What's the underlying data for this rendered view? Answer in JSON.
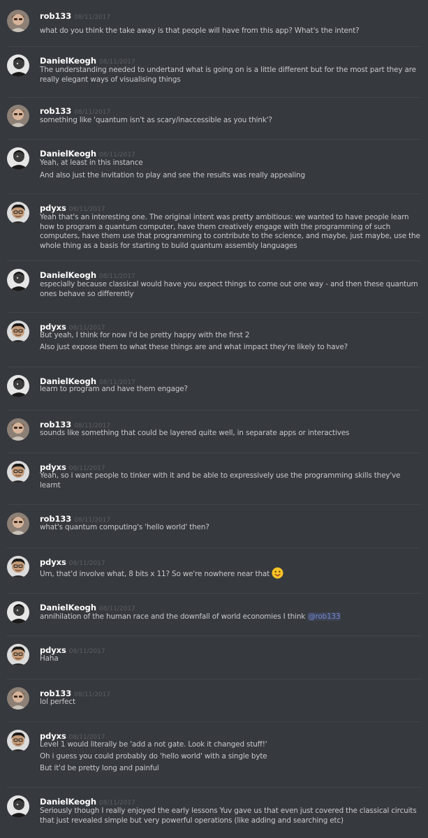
{
  "colors": {
    "background": "#36393e",
    "divider": "#42454a",
    "author": "#ffffff",
    "text": "#c8c9cb",
    "timestamp": "#5b5e63",
    "mention": "#7289da"
  },
  "messages": [
    {
      "author": "rob133",
      "timestamp": "08/11/2017",
      "avatar": "rob133-avatar",
      "lines": [
        "what do you think the take away is that people will have from this app? What's the intent?"
      ]
    },
    {
      "author": "DanielKeogh",
      "timestamp": "08/11/2017",
      "avatar": "danielkeogh-avatar",
      "lines": [
        "The understanding needed to undertand what is going on is a little different but for the most part they are really elegant ways of visualising things"
      ]
    },
    {
      "author": "rob133",
      "timestamp": "08/11/2017",
      "avatar": "rob133-avatar",
      "lines": [
        "something like 'quantum isn't as scary/inaccessible as you think'?"
      ]
    },
    {
      "author": "DanielKeogh",
      "timestamp": "08/11/2017",
      "avatar": "danielkeogh-avatar",
      "lines": [
        "Yeah, at least in this instance",
        "And also just the invitation to play and see the results was really appealing"
      ]
    },
    {
      "author": "pdyxs",
      "timestamp": "08/11/2017",
      "avatar": "pdyxs-avatar",
      "lines": [
        "Yeah that's an interesting one. The original intent was pretty ambitious: we wanted to have people learn how to program a quantum computer, have them creatively engage with the programming of such computers, have them use that programming to contribute to the science, and maybe, just maybe, use the whole thing as a basis for starting to build quantum assembly languages"
      ]
    },
    {
      "author": "DanielKeogh",
      "timestamp": "08/11/2017",
      "avatar": "danielkeogh-avatar",
      "lines": [
        "especially because classical would have you expect things to come out one way - and then these quantum ones behave so differently"
      ]
    },
    {
      "author": "pdyxs",
      "timestamp": "08/11/2017",
      "avatar": "pdyxs-avatar",
      "lines": [
        "But yeah, I think for now I'd be pretty happy with the first 2",
        "Also just expose them to what these things are and what impact they're likely to have?"
      ]
    },
    {
      "author": "DanielKeogh",
      "timestamp": "08/11/2017",
      "avatar": "danielkeogh-avatar",
      "lines": [
        "learn to program and have them engage?"
      ]
    },
    {
      "author": "rob133",
      "timestamp": "08/11/2017",
      "avatar": "rob133-avatar",
      "lines": [
        "sounds like something that could be layered quite well, in separate apps or interactives"
      ]
    },
    {
      "author": "pdyxs",
      "timestamp": "08/11/2017",
      "avatar": "pdyxs-avatar",
      "lines": [
        "Yeah, so i want people to tinker with it and be able to expressively use the programming skills they've learnt"
      ]
    },
    {
      "author": "rob133",
      "timestamp": "08/11/2017",
      "avatar": "rob133-avatar",
      "lines": [
        "what's quantum computing's 'hello world' then?"
      ]
    },
    {
      "author": "pdyxs",
      "timestamp": "08/11/2017",
      "avatar": "pdyxs-avatar",
      "lines": [
        "Um, that'd involve what, 8 bits x 11? So we're nowhere near that"
      ],
      "emoji": "tongue-out-emoji"
    },
    {
      "author": "DanielKeogh",
      "timestamp": "08/11/2017",
      "avatar": "danielkeogh-avatar",
      "lines": [
        "annihilation of the human race and the downfall of world economies I think"
      ],
      "mention": "@rob133"
    },
    {
      "author": "pdyxs",
      "timestamp": "08/11/2017",
      "avatar": "pdyxs-avatar",
      "lines": [
        "Haha"
      ]
    },
    {
      "author": "rob133",
      "timestamp": "08/11/2017",
      "avatar": "rob133-avatar",
      "lines": [
        "lol perfect"
      ]
    },
    {
      "author": "pdyxs",
      "timestamp": "08/11/2017",
      "avatar": "pdyxs-avatar",
      "lines": [
        "Level 1 would literally be 'add a not gate. Look it changed stuff!'",
        "Oh i guess you could probably do 'hello world' with a single byte",
        "But it'd be pretty long and painful"
      ]
    },
    {
      "author": "DanielKeogh",
      "timestamp": "08/11/2017",
      "avatar": "danielkeogh-avatar",
      "lines": [
        "Seriously though I really enjoyed the early lessons Yuv gave us that even just covered the classical circuits that just revealed simple but very powerful operations (like adding and searching etc)"
      ]
    }
  ]
}
